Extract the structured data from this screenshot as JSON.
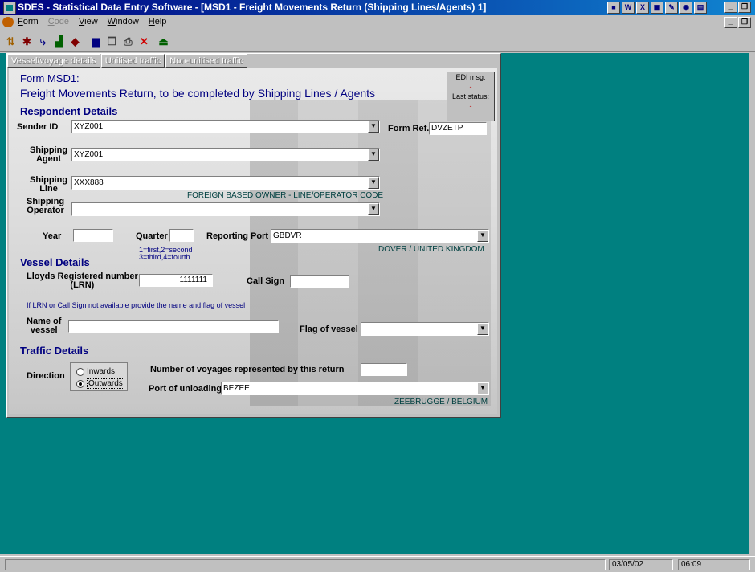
{
  "window": {
    "title": "SDES - Statistical Data Entry Software - [MSD1 - Freight Movements Return (Shipping Lines/Agents) 1]"
  },
  "menu": [
    "Form",
    "Code",
    "View",
    "Window",
    "Help"
  ],
  "tabs": [
    "Vessel/voyage details",
    "Unitised traffic",
    "Non-unitised traffic"
  ],
  "form": {
    "code": "Form MSD1:",
    "subtitle": "Freight Movements Return, to be completed by Shipping Lines / Agents",
    "edi_msg_label": "EDI msg:",
    "edi_msg_value": "-",
    "last_status_label": "Last status:",
    "last_status_value": "-"
  },
  "respondent": {
    "heading": "Respondent Details",
    "sender_id_label": "Sender ID",
    "sender_id_value": "XYZ001",
    "form_ref_label": "Form Ref.",
    "form_ref_value": "DVZETP",
    "shipping_agent_label_1": "Shipping",
    "shipping_agent_label_2": "Agent",
    "shipping_agent_value": "XYZ001",
    "shipping_line_label_1": "Shipping",
    "shipping_line_label_2": "Line",
    "shipping_line_value": "XXX888",
    "shipping_line_desc": "FOREIGN BASED OWNER - LINE/OPERATOR CODE",
    "shipping_operator_label_1": "Shipping",
    "shipping_operator_label_2": "Operator",
    "shipping_operator_value": "",
    "year_label": "Year",
    "year_value": "",
    "quarter_label": "Quarter",
    "quarter_value": "",
    "quarter_hint_1": "1=first,2=second",
    "quarter_hint_2": "3=third,4=fourth",
    "reporting_port_label": "Reporting Port",
    "reporting_port_value": "GBDVR",
    "reporting_port_desc": "DOVER / UNITED KINGDOM"
  },
  "vessel": {
    "heading": "Vessel Details",
    "lrn_label_1": "Lloyds Registered number",
    "lrn_label_2": "(LRN)",
    "lrn_value": "1111111",
    "call_sign_label": "Call Sign",
    "call_sign_value": "",
    "hint": "If LRN or Call Sign not available provide the name and flag of vessel",
    "name_label_1": "Name of",
    "name_label_2": "vessel",
    "name_value": "",
    "flag_label": "Flag of vessel",
    "flag_value": ""
  },
  "traffic": {
    "heading": "Traffic Details",
    "direction_label": "Direction",
    "inwards": "Inwards",
    "outwards": "Outwards",
    "selected": "Outwards",
    "voyages_label": "Number of voyages represented by this return",
    "voyages_value": "",
    "unloading_label": "Port of unloading",
    "unloading_value": "BEZEE",
    "unloading_desc": "ZEEBRUGGE / BELGIUM"
  },
  "status": {
    "date": "03/05/02",
    "time": "06:09"
  },
  "colors": {
    "title_bar": "#000080",
    "desktop": "#008080",
    "heading": "#000080"
  }
}
